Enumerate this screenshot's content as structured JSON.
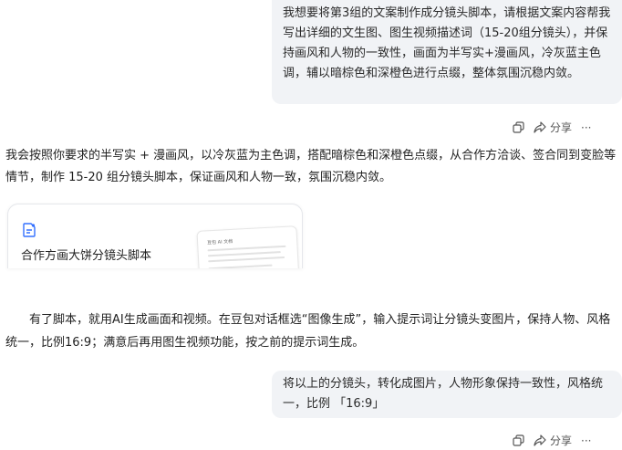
{
  "user_message_1": "我想要将第3组的文案制作成分镜头脚本，请根据文案内容帮我写出详细的文生图、图生视频描述词（15-20组分镜头），并保持画风和人物的一致性，画面为半写实+漫画风，冷灰蓝主色调，辅以暗棕色和深橙色进行点缀，整体氛围沉稳内敛。",
  "actions_1": {
    "share_label": "分享",
    "more_label": "···"
  },
  "assistant_reply": "我会按照你要求的半写实 + 漫画风，以冷灰蓝为主色调，搭配暗棕色和深橙色点缀，从合作方洽谈、签合同到变脸等情节，制作 15-20 组分镜头脚本，保证画风和人物一致，氛围沉稳内敛。",
  "doc_card": {
    "title": "合作方画大饼分镜头脚本",
    "preview_heading": "豆包 AI 文档"
  },
  "article_paragraph": "有了脚本，就用AI生成画面和视频。在豆包对话框选“图像生成”，输入提示词让分镜头变图片，保持人物、风格统一，比例16:9；满意后再用图生视频功能，按之前的提示词生成。",
  "user_message_2": "将以上的分镜头，转化成图片，人物形象保持一致性，风格统一，比例 「16:9」",
  "actions_2": {
    "share_label": "分享",
    "more_label": "···"
  },
  "colors": {
    "bubble_bg": "#f1f3f6",
    "doc_icon_blue": "#3370ff",
    "text": "#1f1f1f"
  }
}
